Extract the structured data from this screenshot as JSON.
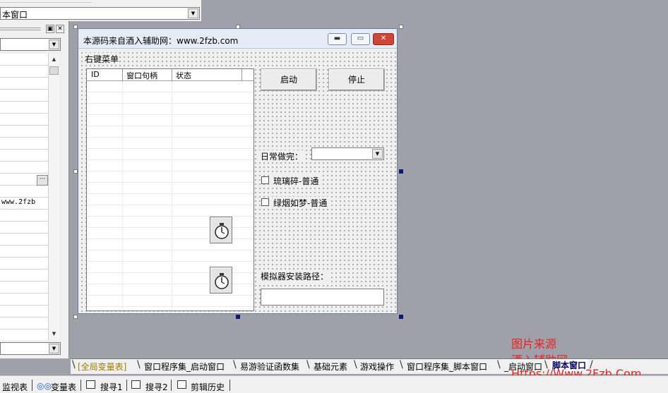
{
  "top_combo": {
    "value": "本窗口"
  },
  "left_panel": {
    "pin_icon": "▣",
    "close_icon": "✕",
    "cell_value": "www.2fzb",
    "ellipsis": "···"
  },
  "window": {
    "title": "本源码来自酒入辅助网：www.2fzb.com",
    "minimize": "▬",
    "maximize": "▭",
    "close": "✕",
    "menu_label": "右键菜单"
  },
  "listview": {
    "columns": [
      "ID",
      "窗口句柄",
      "状态"
    ]
  },
  "buttons": {
    "start": "启动",
    "stop": "停止"
  },
  "labels": {
    "daily": "日常做完：",
    "check1": "琉璃碎-普通",
    "check2": "绿烟如梦-普通",
    "emu_path": "模拟器安装路径："
  },
  "tabs": [
    "[全局变量表]",
    "窗口程序集_启动窗口",
    "易游验证函数集",
    "基础元素",
    "游戏操作",
    "窗口程序集_脚本窗口",
    "_启动窗口",
    "脚本窗口"
  ],
  "status_bar": [
    "监视表",
    "变量表",
    "搜寻1",
    "搜寻2",
    "剪辑历史"
  ],
  "watermark": {
    "line1": "图片来源",
    "line2": "酒入辅助网",
    "line3": "Https://Www.2Fzb.Com"
  },
  "colors": {
    "desktop": "#a0a0ab",
    "watermark": "#e8231c",
    "active_tab": "#000066",
    "close_button": "#cf4536"
  },
  "icons": {
    "timer": "stopwatch-icon",
    "dropdown": "chevron-down-icon"
  }
}
